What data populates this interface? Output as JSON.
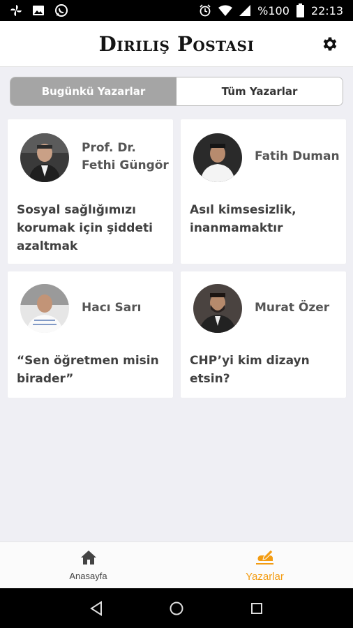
{
  "status_bar": {
    "battery_text": "%100",
    "time": "22:13",
    "left_icons": [
      "fan-icon",
      "image-icon",
      "whatsapp-icon"
    ],
    "right_icons": [
      "alarm-icon",
      "wifi-icon",
      "signal-icon",
      "battery-icon"
    ]
  },
  "header": {
    "logo": "Diriliş Postası",
    "settings_icon": "gear-icon"
  },
  "segment": {
    "tabs": [
      {
        "label": "Bugünkü Yazarlar",
        "active": true
      },
      {
        "label": "Tüm Yazarlar",
        "active": false
      }
    ]
  },
  "authors": [
    {
      "name_line1": "Prof. Dr.",
      "name_line2": "Fethi Güngör",
      "title_lines": [
        "Sosyal sağlığımızı",
        "korumak için şiddeti",
        "azaltmak"
      ]
    },
    {
      "name_line1": "Fatih Duman",
      "name_line2": "",
      "title_lines": [
        "Asıl kimsesizlik,",
        "inanmamaktır",
        ""
      ]
    },
    {
      "name_line1": "Hacı Sarı",
      "name_line2": "",
      "title_lines": [
        "“Sen öğretmen misin",
        "birader”",
        ""
      ]
    },
    {
      "name_line1": "Murat Özer",
      "name_line2": "",
      "title_lines": [
        "CHP’yi kim dizayn",
        "etsin?",
        ""
      ]
    }
  ],
  "bottom_nav": {
    "items": [
      {
        "label": "Anasayfa",
        "icon": "home-icon",
        "active": false
      },
      {
        "label": "Yazarlar",
        "icon": "pen-hand-icon",
        "active": true
      }
    ],
    "active_color": "#f39c12"
  },
  "system_nav": [
    "back-icon",
    "home-circle-icon",
    "recents-icon"
  ]
}
